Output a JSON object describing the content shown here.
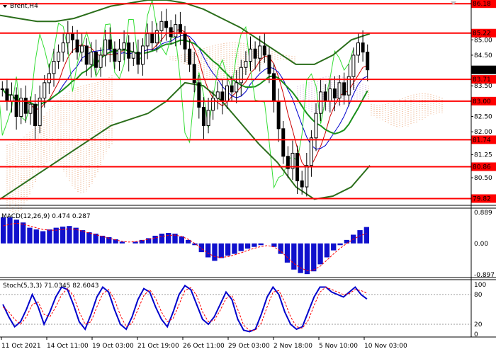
{
  "window": {
    "title": "Brent,H4"
  },
  "colors": {
    "background": "#ffffff",
    "candle": "#000000",
    "red_level": "#ff0000",
    "level_label_bg": "#ff0000",
    "current_price_bg": "#000000",
    "bollinger": "#2b6e1b",
    "ma_green": "#1a8f1a",
    "ma_red": "#cc0000",
    "ma_blue": "#0000cc",
    "chikou": "#33dd33",
    "cloud_orange": "#e8a070",
    "cloud_pink": "#c8a0d8",
    "macd_bar": "#1010cc",
    "macd_signal": "#ff0000",
    "stoch_main": "#0000cc",
    "stoch_signal": "#ff0000"
  },
  "price_axis": {
    "labels": [
      "85.00",
      "84.50",
      "83.50",
      "82.50",
      "82.00",
      "81.25",
      "80.50"
    ],
    "tag_labels": [
      "86.18",
      "85.22",
      "84.02",
      "83.71",
      "83.00",
      "81.74",
      "80.86",
      "79.82"
    ],
    "current_price": "84.02"
  },
  "red_levels": [
    "86.18",
    "85.22",
    "83.71",
    "83.00",
    "81.74",
    "80.86",
    "79.82"
  ],
  "macd": {
    "label": "MACD(12,26,9) 0.474 0.287",
    "axis_labels": [
      "0.889",
      "0.00",
      "-0.897"
    ]
  },
  "stochastic": {
    "label": "Stoch(5,3,3) 71.0345 82.6043",
    "axis_labels": [
      "100",
      "80",
      "20",
      "0"
    ]
  },
  "time_axis": {
    "labels": [
      "11 Oct 2021",
      "14 Oct 11:00",
      "19 Oct 03:00",
      "21 Oct 19:00",
      "26 Oct 11:00",
      "29 Oct 03:00",
      "2 Nov 18:00",
      "5 Nov 10:00",
      "10 Nov 03:00"
    ]
  },
  "chart_data": {
    "type": "candlestick",
    "title": "Brent,H4",
    "ylim": [
      79.6,
      86.3
    ],
    "support_resistance_levels": [
      86.18,
      85.22,
      83.71,
      83.0,
      81.74,
      80.86,
      79.82
    ],
    "current_price": 84.02,
    "close_series": [
      83.4,
      83.0,
      83.2,
      82.5,
      83.1,
      82.6,
      82.9,
      82.2,
      83.1,
      83.6,
      83.9,
      84.3,
      84.6,
      84.9,
      85.2,
      85.0,
      84.6,
      84.8,
      84.2,
      84.6,
      84.1,
      84.5,
      85.0,
      84.7,
      84.3,
      84.7,
      84.9,
      84.4,
      84.6,
      84.2,
      84.8,
      85.2,
      84.9,
      85.3,
      85.6,
      85.4,
      85.1,
      85.5,
      85.2,
      84.7,
      84.2,
      83.6,
      82.8,
      82.2,
      82.7,
      83.1,
      83.3,
      83.0,
      83.5,
      83.3,
      83.6,
      84.1,
      84.3,
      84.7,
      84.4,
      84.8,
      84.5,
      83.9,
      83.0,
      82.1,
      81.2,
      80.8,
      81.3,
      80.4,
      80.2,
      80.9,
      81.8,
      82.6,
      83.3,
      83.0,
      83.4,
      83.1,
      83.6,
      83.2,
      83.8,
      84.5,
      84.9,
      84.6,
      84.02
    ],
    "upper_band": [
      85.8,
      85.7,
      85.6,
      85.6,
      85.7,
      85.9,
      86.1,
      86.2,
      86.3,
      86.3,
      86.2,
      86.0,
      85.7,
      85.4,
      85.0,
      84.6,
      84.2,
      84.2,
      84.5,
      85.0,
      85.2
    ],
    "lower_band": [
      79.8,
      80.2,
      80.6,
      81.0,
      81.4,
      81.8,
      82.2,
      82.4,
      82.6,
      83.0,
      83.6,
      83.5,
      83.0,
      82.3,
      81.6,
      81.0,
      80.2,
      79.8,
      79.9,
      80.2,
      80.9
    ],
    "macd": {
      "ylim": [
        -0.897,
        0.889
      ],
      "histogram": [
        0.75,
        0.75,
        0.68,
        0.6,
        0.45,
        0.4,
        0.35,
        0.4,
        0.45,
        0.48,
        0.5,
        0.45,
        0.38,
        0.32,
        0.28,
        0.22,
        0.18,
        0.12,
        0.05,
        0.0,
        0.05,
        0.1,
        0.15,
        0.22,
        0.28,
        0.3,
        0.28,
        0.2,
        0.1,
        -0.05,
        -0.25,
        -0.4,
        -0.5,
        -0.42,
        -0.35,
        -0.3,
        -0.22,
        -0.15,
        -0.1,
        -0.05,
        0.0,
        -0.1,
        -0.3,
        -0.55,
        -0.75,
        -0.85,
        -0.88,
        -0.8,
        -0.6,
        -0.4,
        -0.2,
        -0.05,
        0.1,
        0.25,
        0.38,
        0.47
      ],
      "signal": [
        0.5,
        0.55,
        0.58,
        0.55,
        0.5,
        0.45,
        0.4,
        0.38,
        0.38,
        0.4,
        0.42,
        0.4,
        0.35,
        0.3,
        0.25,
        0.2,
        0.15,
        0.1,
        0.06,
        0.04,
        0.05,
        0.08,
        0.12,
        0.16,
        0.2,
        0.23,
        0.24,
        0.2,
        0.12,
        0.0,
        -0.15,
        -0.28,
        -0.38,
        -0.4,
        -0.38,
        -0.33,
        -0.27,
        -0.2,
        -0.14,
        -0.09,
        -0.06,
        -0.1,
        -0.22,
        -0.4,
        -0.58,
        -0.7,
        -0.78,
        -0.76,
        -0.65,
        -0.48,
        -0.3,
        -0.14,
        0.0,
        0.12,
        0.22,
        0.287
      ]
    },
    "stochastic": {
      "ylim": [
        0,
        100
      ],
      "main": [
        60,
        35,
        15,
        25,
        50,
        80,
        55,
        20,
        45,
        75,
        95,
        90,
        60,
        25,
        10,
        40,
        75,
        95,
        85,
        50,
        20,
        10,
        35,
        70,
        92,
        85,
        55,
        30,
        15,
        45,
        80,
        98,
        90,
        60,
        30,
        20,
        35,
        60,
        85,
        70,
        30,
        8,
        5,
        10,
        40,
        75,
        95,
        80,
        45,
        20,
        10,
        15,
        45,
        75,
        95,
        95,
        85,
        80,
        75,
        85,
        95,
        80,
        71.0345
      ],
      "signal": [
        55,
        45,
        30,
        20,
        35,
        60,
        65,
        40,
        35,
        55,
        80,
        92,
        78,
        45,
        20,
        25,
        55,
        82,
        90,
        70,
        38,
        15,
        22,
        50,
        78,
        90,
        72,
        45,
        25,
        32,
        60,
        88,
        94,
        78,
        45,
        25,
        28,
        48,
        72,
        78,
        50,
        18,
        8,
        8,
        22,
        55,
        85,
        88,
        65,
        35,
        15,
        12,
        28,
        58,
        85,
        95,
        90,
        85,
        80,
        82,
        90,
        88,
        82.6043
      ]
    }
  }
}
